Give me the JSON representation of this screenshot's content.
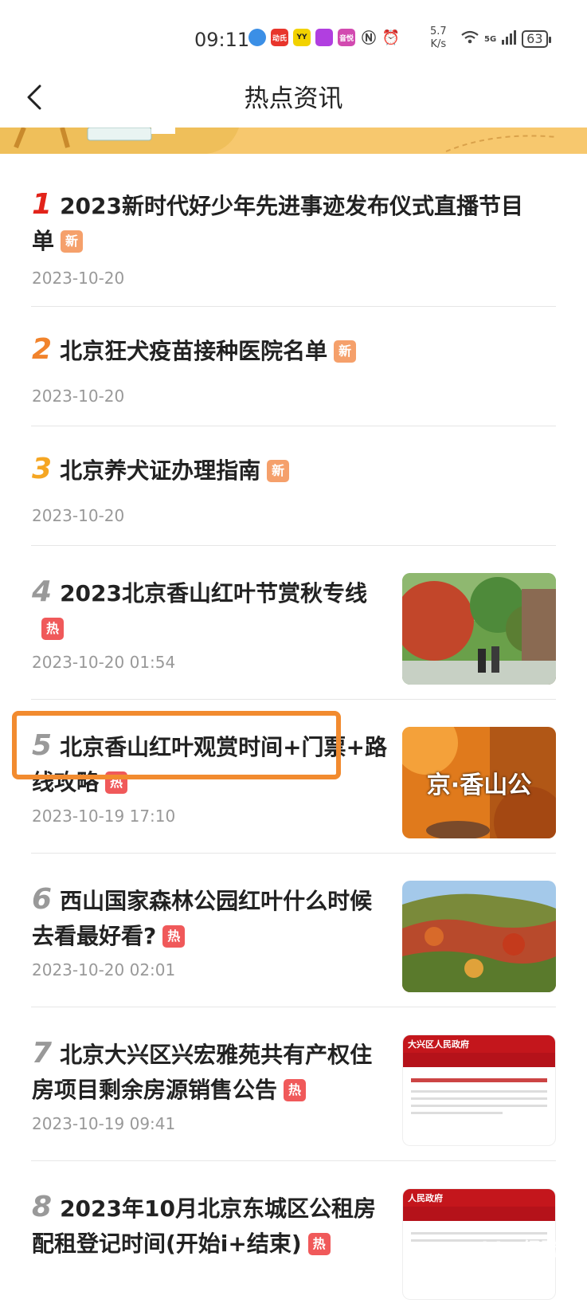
{
  "status_bar": {
    "time": "09:11",
    "speed_value": "5.7",
    "speed_unit": "K/s",
    "network": "5G",
    "battery": "63",
    "app_icons": [
      {
        "name": "browser-icon",
        "color": "#3b8fe6",
        "label": ""
      },
      {
        "name": "app-icon-1",
        "color": "#e8352c",
        "label": "动氏"
      },
      {
        "name": "yy-icon",
        "color": "#f2d200",
        "label": "YY"
      },
      {
        "name": "app-icon-2",
        "color": "#b13fe0",
        "label": ""
      },
      {
        "name": "app-icon-3",
        "color": "#d24ab0",
        "label": "音悦"
      }
    ]
  },
  "header": {
    "title": "热点资讯"
  },
  "colors": {
    "rank1": "#e2231a",
    "rank2": "#f1832c",
    "rank3": "#f5a623",
    "rank_other": "#999999",
    "badge_new": "#f5a06b",
    "badge_hot": "#f0595a"
  },
  "items": [
    {
      "rank": "1",
      "title": "2023新时代好少年先进事迹发布仪式直播节目单",
      "badge": "新",
      "badge_type": "new",
      "date": "2023-10-20",
      "has_image": false
    },
    {
      "rank": "2",
      "title": "北京狂犬疫苗接种医院名单",
      "badge": "新",
      "badge_type": "new",
      "date": "2023-10-20",
      "has_image": false
    },
    {
      "rank": "3",
      "title": "北京养犬证办理指南",
      "badge": "新",
      "badge_type": "new",
      "date": "2023-10-20",
      "has_image": false
    },
    {
      "rank": "4",
      "title": "2023北京香山红叶节赏秋专线",
      "badge": "热",
      "badge_type": "hot",
      "date": "2023-10-20 01:54",
      "has_image": true
    },
    {
      "rank": "5",
      "title": "北京香山红叶观赏时间+门票+路线攻略",
      "badge": "热",
      "badge_type": "hot",
      "date": "2023-10-19 17:10",
      "has_image": true,
      "image_text": "京·香山公"
    },
    {
      "rank": "6",
      "title": "西山国家森林公园红叶什么时候去看最好看?",
      "badge": "热",
      "badge_type": "hot",
      "date": "2023-10-20 02:01",
      "has_image": true
    },
    {
      "rank": "7",
      "title": "北京大兴区兴宏雅苑共有产权住房项目剩余房源销售公告",
      "badge": "热",
      "badge_type": "hot",
      "date": "2023-10-19 09:41",
      "has_image": true,
      "image_text": "大兴区人民政府"
    },
    {
      "rank": "8",
      "title": "2023年10月北京东城区公租房配租登记时间(开始i+结束)",
      "badge": "热",
      "badge_type": "hot",
      "date": "",
      "has_image": true,
      "image_text": "人民政府"
    }
  ],
  "watermark": "Baidu 经验"
}
